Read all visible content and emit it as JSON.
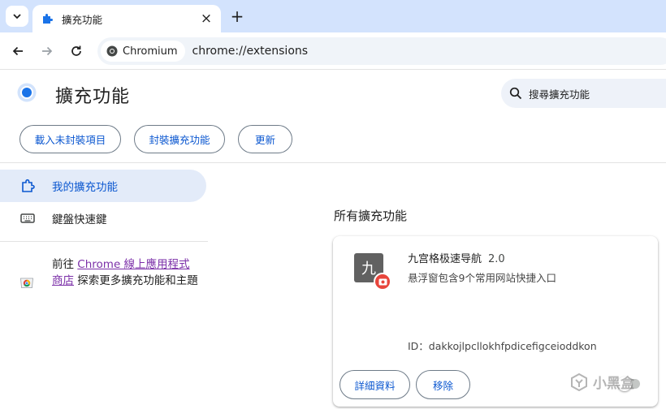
{
  "browser": {
    "tab_title": "擴充功能",
    "chip_label": "Chromium",
    "url": "chrome://extensions"
  },
  "header": {
    "title": "擴充功能",
    "search_placeholder": "搜尋擴充功能"
  },
  "toolbar_buttons": {
    "load_unpacked": "載入未封裝項目",
    "pack": "封裝擴充功能",
    "update": "更新"
  },
  "sidebar": {
    "items": [
      {
        "label": "我的擴充功能",
        "active": true,
        "icon": "puzzle-icon"
      },
      {
        "label": "鍵盤快速鍵",
        "active": false,
        "icon": "keyboard-icon"
      }
    ],
    "webstore_prefix": "前往",
    "webstore_link": "Chrome 線上應用程式商店",
    "webstore_suffix": "探索更多擴充功能和主題"
  },
  "main": {
    "section_title": "所有擴充功能",
    "extension": {
      "icon_char": "九",
      "name": "九宫格极速导航",
      "version": "2.0",
      "description": "悬浮窗包含9个常用网站快捷入口",
      "id_text": "ID：dakkojlpcllokhfpdicefigceioddkon",
      "details_label": "詳細資料",
      "remove_label": "移除",
      "enabled": false
    }
  },
  "watermark": "小黑盒",
  "colors": {
    "tabstrip": "#d3e3fd",
    "accent": "#0b57d0",
    "sidebar_active": "#e3ebf9",
    "badge": "#e8453c"
  }
}
